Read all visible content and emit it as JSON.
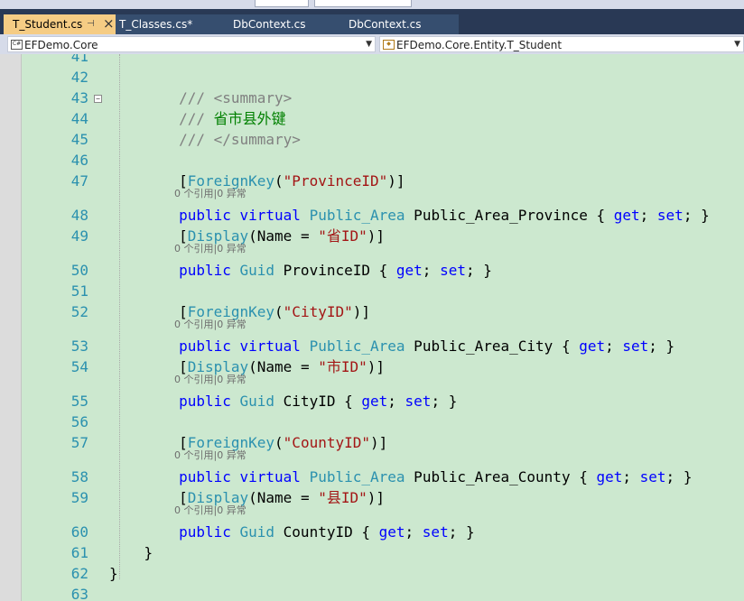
{
  "tabs": [
    {
      "label": "T_Student.cs",
      "active": true
    },
    {
      "label": "T_Classes.cs*",
      "active": false
    },
    {
      "label": "DbContext.cs",
      "active": false
    },
    {
      "label": "DbContext.cs",
      "active": false
    }
  ],
  "nav": {
    "project": "EFDemo.Core",
    "type": "EFDemo.Core.Entity.T_Student"
  },
  "lens_text": "0 个引用|0 异常",
  "colors": {
    "background": "#cce8cf",
    "keyword": "#0000ff",
    "type": "#2b91af",
    "string": "#a31515",
    "comment": "#008000",
    "line_number": "#2b91af",
    "tab_active": "#f5cc84"
  },
  "code_lines": [
    {
      "num": "41",
      "tokens": []
    },
    {
      "num": "42",
      "tokens": []
    },
    {
      "num": "43",
      "fold": "−",
      "tokens": [
        {
          "t": "        ",
          "c": "pl"
        },
        {
          "t": "/// ",
          "c": "cg"
        },
        {
          "t": "<summary>",
          "c": "cg"
        }
      ]
    },
    {
      "num": "44",
      "tokens": [
        {
          "t": "        ",
          "c": "pl"
        },
        {
          "t": "/// ",
          "c": "cg"
        },
        {
          "t": "省市县外键",
          "c": "cm"
        }
      ]
    },
    {
      "num": "45",
      "tokens": [
        {
          "t": "        ",
          "c": "pl"
        },
        {
          "t": "/// ",
          "c": "cg"
        },
        {
          "t": "</summary>",
          "c": "cg"
        }
      ]
    },
    {
      "num": "46",
      "tokens": []
    },
    {
      "num": "47",
      "lens_after": true,
      "tokens": [
        {
          "t": "        [",
          "c": "pl"
        },
        {
          "t": "ForeignKey",
          "c": "ty"
        },
        {
          "t": "(",
          "c": "pl"
        },
        {
          "t": "\"ProvinceID\"",
          "c": "st"
        },
        {
          "t": ")]",
          "c": "pl"
        }
      ]
    },
    {
      "num": "48",
      "tokens": [
        {
          "t": "        ",
          "c": "pl"
        },
        {
          "t": "public",
          "c": "kw"
        },
        {
          "t": " ",
          "c": "pl"
        },
        {
          "t": "virtual",
          "c": "kw"
        },
        {
          "t": " ",
          "c": "pl"
        },
        {
          "t": "Public_Area",
          "c": "ty"
        },
        {
          "t": " Public_Area_Province { ",
          "c": "pl"
        },
        {
          "t": "get",
          "c": "kw"
        },
        {
          "t": "; ",
          "c": "pl"
        },
        {
          "t": "set",
          "c": "kw"
        },
        {
          "t": "; }",
          "c": "pl"
        }
      ]
    },
    {
      "num": "49",
      "lens_after": true,
      "tokens": [
        {
          "t": "        [",
          "c": "pl"
        },
        {
          "t": "Display",
          "c": "ty"
        },
        {
          "t": "(Name = ",
          "c": "pl"
        },
        {
          "t": "\"省ID\"",
          "c": "st"
        },
        {
          "t": ")]",
          "c": "pl"
        }
      ]
    },
    {
      "num": "50",
      "tokens": [
        {
          "t": "        ",
          "c": "pl"
        },
        {
          "t": "public",
          "c": "kw"
        },
        {
          "t": " ",
          "c": "pl"
        },
        {
          "t": "Guid",
          "c": "ty"
        },
        {
          "t": " ProvinceID { ",
          "c": "pl"
        },
        {
          "t": "get",
          "c": "kw"
        },
        {
          "t": "; ",
          "c": "pl"
        },
        {
          "t": "set",
          "c": "kw"
        },
        {
          "t": "; }",
          "c": "pl"
        }
      ]
    },
    {
      "num": "51",
      "tokens": []
    },
    {
      "num": "52",
      "lens_after": true,
      "tokens": [
        {
          "t": "        [",
          "c": "pl"
        },
        {
          "t": "ForeignKey",
          "c": "ty"
        },
        {
          "t": "(",
          "c": "pl"
        },
        {
          "t": "\"CityID\"",
          "c": "st"
        },
        {
          "t": ")]",
          "c": "pl"
        }
      ]
    },
    {
      "num": "53",
      "tokens": [
        {
          "t": "        ",
          "c": "pl"
        },
        {
          "t": "public",
          "c": "kw"
        },
        {
          "t": " ",
          "c": "pl"
        },
        {
          "t": "virtual",
          "c": "kw"
        },
        {
          "t": " ",
          "c": "pl"
        },
        {
          "t": "Public_Area",
          "c": "ty"
        },
        {
          "t": " Public_Area_City { ",
          "c": "pl"
        },
        {
          "t": "get",
          "c": "kw"
        },
        {
          "t": "; ",
          "c": "pl"
        },
        {
          "t": "set",
          "c": "kw"
        },
        {
          "t": "; }",
          "c": "pl"
        }
      ]
    },
    {
      "num": "54",
      "lens_after": true,
      "tokens": [
        {
          "t": "        [",
          "c": "pl"
        },
        {
          "t": "Display",
          "c": "ty"
        },
        {
          "t": "(Name = ",
          "c": "pl"
        },
        {
          "t": "\"市ID\"",
          "c": "st"
        },
        {
          "t": ")]",
          "c": "pl"
        }
      ]
    },
    {
      "num": "55",
      "tokens": [
        {
          "t": "        ",
          "c": "pl"
        },
        {
          "t": "public",
          "c": "kw"
        },
        {
          "t": " ",
          "c": "pl"
        },
        {
          "t": "Guid",
          "c": "ty"
        },
        {
          "t": " CityID { ",
          "c": "pl"
        },
        {
          "t": "get",
          "c": "kw"
        },
        {
          "t": "; ",
          "c": "pl"
        },
        {
          "t": "set",
          "c": "kw"
        },
        {
          "t": "; }",
          "c": "pl"
        }
      ]
    },
    {
      "num": "56",
      "tokens": []
    },
    {
      "num": "57",
      "lens_after": true,
      "tokens": [
        {
          "t": "        [",
          "c": "pl"
        },
        {
          "t": "ForeignKey",
          "c": "ty"
        },
        {
          "t": "(",
          "c": "pl"
        },
        {
          "t": "\"CountyID\"",
          "c": "st"
        },
        {
          "t": ")]",
          "c": "pl"
        }
      ]
    },
    {
      "num": "58",
      "tokens": [
        {
          "t": "        ",
          "c": "pl"
        },
        {
          "t": "public",
          "c": "kw"
        },
        {
          "t": " ",
          "c": "pl"
        },
        {
          "t": "virtual",
          "c": "kw"
        },
        {
          "t": " ",
          "c": "pl"
        },
        {
          "t": "Public_Area",
          "c": "ty"
        },
        {
          "t": " Public_Area_County { ",
          "c": "pl"
        },
        {
          "t": "get",
          "c": "kw"
        },
        {
          "t": "; ",
          "c": "pl"
        },
        {
          "t": "set",
          "c": "kw"
        },
        {
          "t": "; }",
          "c": "pl"
        }
      ]
    },
    {
      "num": "59",
      "lens_after": true,
      "tokens": [
        {
          "t": "        [",
          "c": "pl"
        },
        {
          "t": "Display",
          "c": "ty"
        },
        {
          "t": "(Name = ",
          "c": "pl"
        },
        {
          "t": "\"县ID\"",
          "c": "st"
        },
        {
          "t": ")]",
          "c": "pl"
        }
      ]
    },
    {
      "num": "60",
      "tokens": [
        {
          "t": "        ",
          "c": "pl"
        },
        {
          "t": "public",
          "c": "kw"
        },
        {
          "t": " ",
          "c": "pl"
        },
        {
          "t": "Guid",
          "c": "ty"
        },
        {
          "t": " CountyID { ",
          "c": "pl"
        },
        {
          "t": "get",
          "c": "kw"
        },
        {
          "t": "; ",
          "c": "pl"
        },
        {
          "t": "set",
          "c": "kw"
        },
        {
          "t": "; }",
          "c": "pl"
        }
      ]
    },
    {
      "num": "61",
      "tokens": [
        {
          "t": "    }",
          "c": "pl"
        }
      ]
    },
    {
      "num": "62",
      "tokens": [
        {
          "t": "}",
          "c": "pl"
        }
      ]
    },
    {
      "num": "63",
      "tokens": []
    }
  ]
}
